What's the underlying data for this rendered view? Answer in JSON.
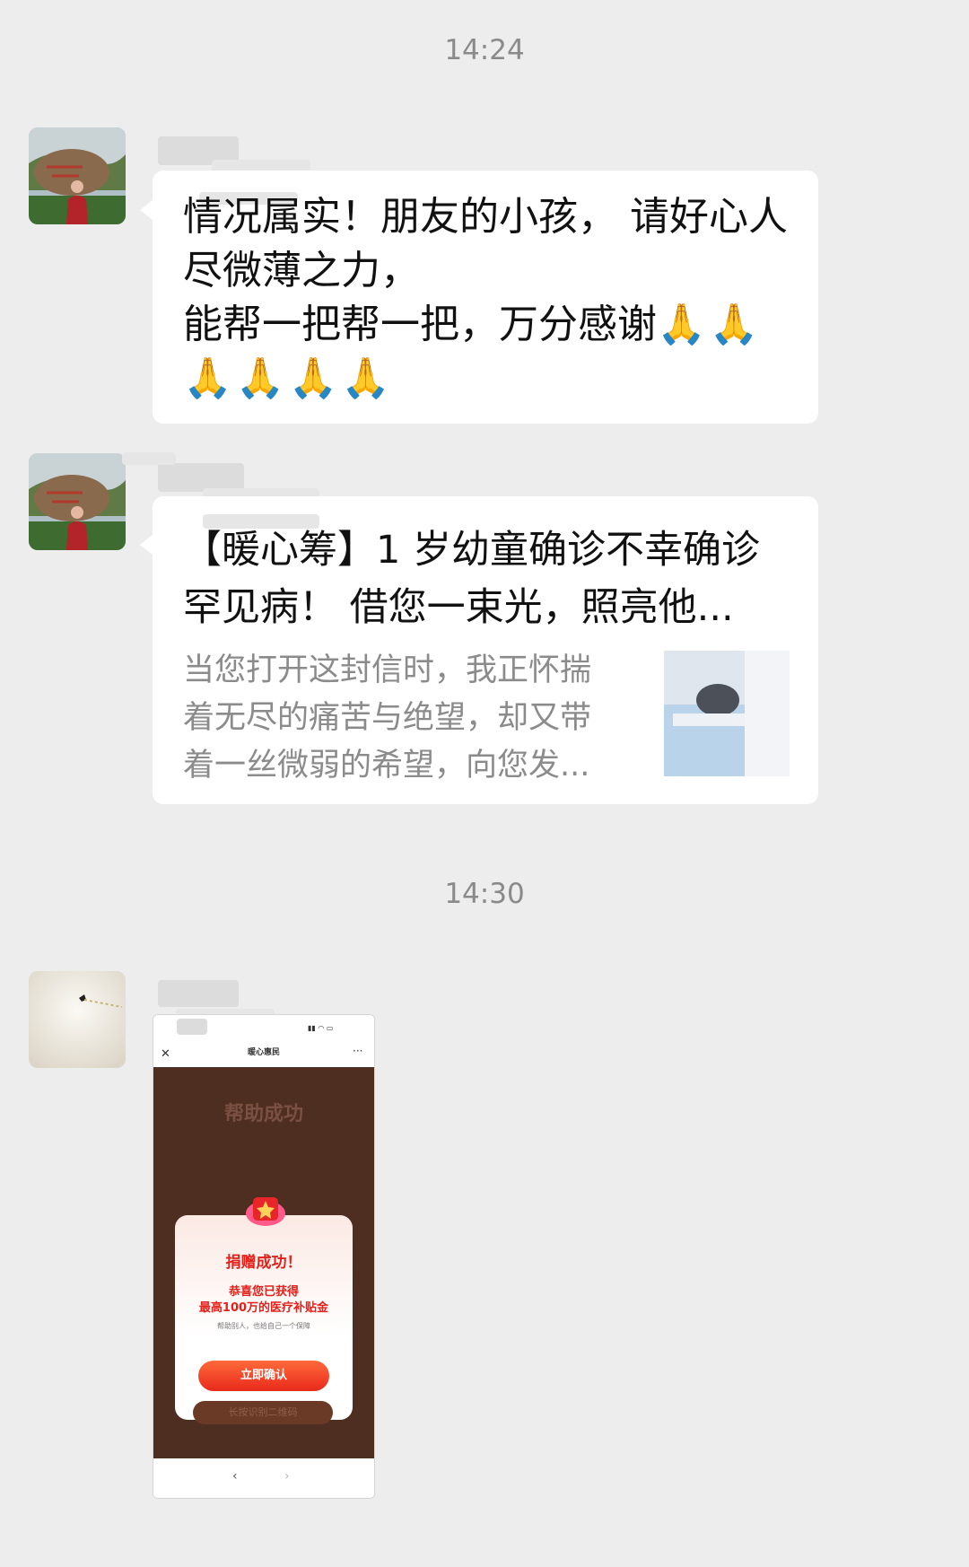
{
  "timestamps": [
    "14:24",
    "14:30"
  ],
  "messages": {
    "m1": {
      "lines": [
        "情况属实！朋友的小孩， 请好心人尽微薄之力，",
        "能帮一把帮一把，万分感谢"
      ],
      "emoji": "🙏🙏🙏🙏🙏🙏"
    },
    "m2": {
      "title": "【暖心筹】1 岁幼童确诊不幸确诊罕见病！ 借您一束光，照亮他...",
      "desc": "当您打开这封信时，我正怀揣着无尽的痛苦与绝望，却又带着一丝微弱的希望，向您发..."
    },
    "m3": {
      "app_title": "暖心惠民",
      "bg_heading": "帮助成功",
      "modal_title": "捐赠成功！",
      "modal_line1": "恭喜您已获得",
      "modal_line2": "最高100万的医疗补贴金",
      "modal_small": "帮助别人，也给自己一个保障",
      "confirm_button": "立即确认",
      "bottom_button": "长按识别二维码",
      "close_icon": "close-icon",
      "more_icon": "more-icon"
    }
  }
}
